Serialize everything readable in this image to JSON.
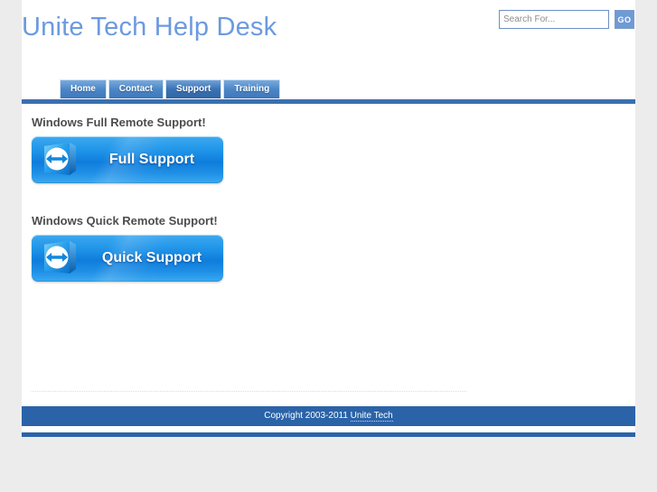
{
  "site": {
    "title": "Unite Tech Help Desk",
    "title_color": "#6b9ae0",
    "accent_color": "#2b63a8",
    "background_color": "#ececec"
  },
  "search": {
    "placeholder": "Search For...",
    "value": "",
    "button_label": "GO"
  },
  "nav": {
    "tabs": [
      {
        "label": "Home",
        "active": false
      },
      {
        "label": "Contact",
        "active": false
      },
      {
        "label": "Support",
        "active": true
      },
      {
        "label": "Training",
        "active": false
      }
    ]
  },
  "main": {
    "sections": [
      {
        "heading": "Windows Full Remote Support!",
        "button_label": "Full Support",
        "button_icon": "teamviewer-icon"
      },
      {
        "heading": "Windows Quick Remote Support!",
        "button_label": "Quick Support",
        "button_icon": "teamviewer-icon"
      }
    ]
  },
  "footer": {
    "copyright_prefix": "Copyright 2003-2011 ",
    "link_label": "Unite Tech"
  }
}
